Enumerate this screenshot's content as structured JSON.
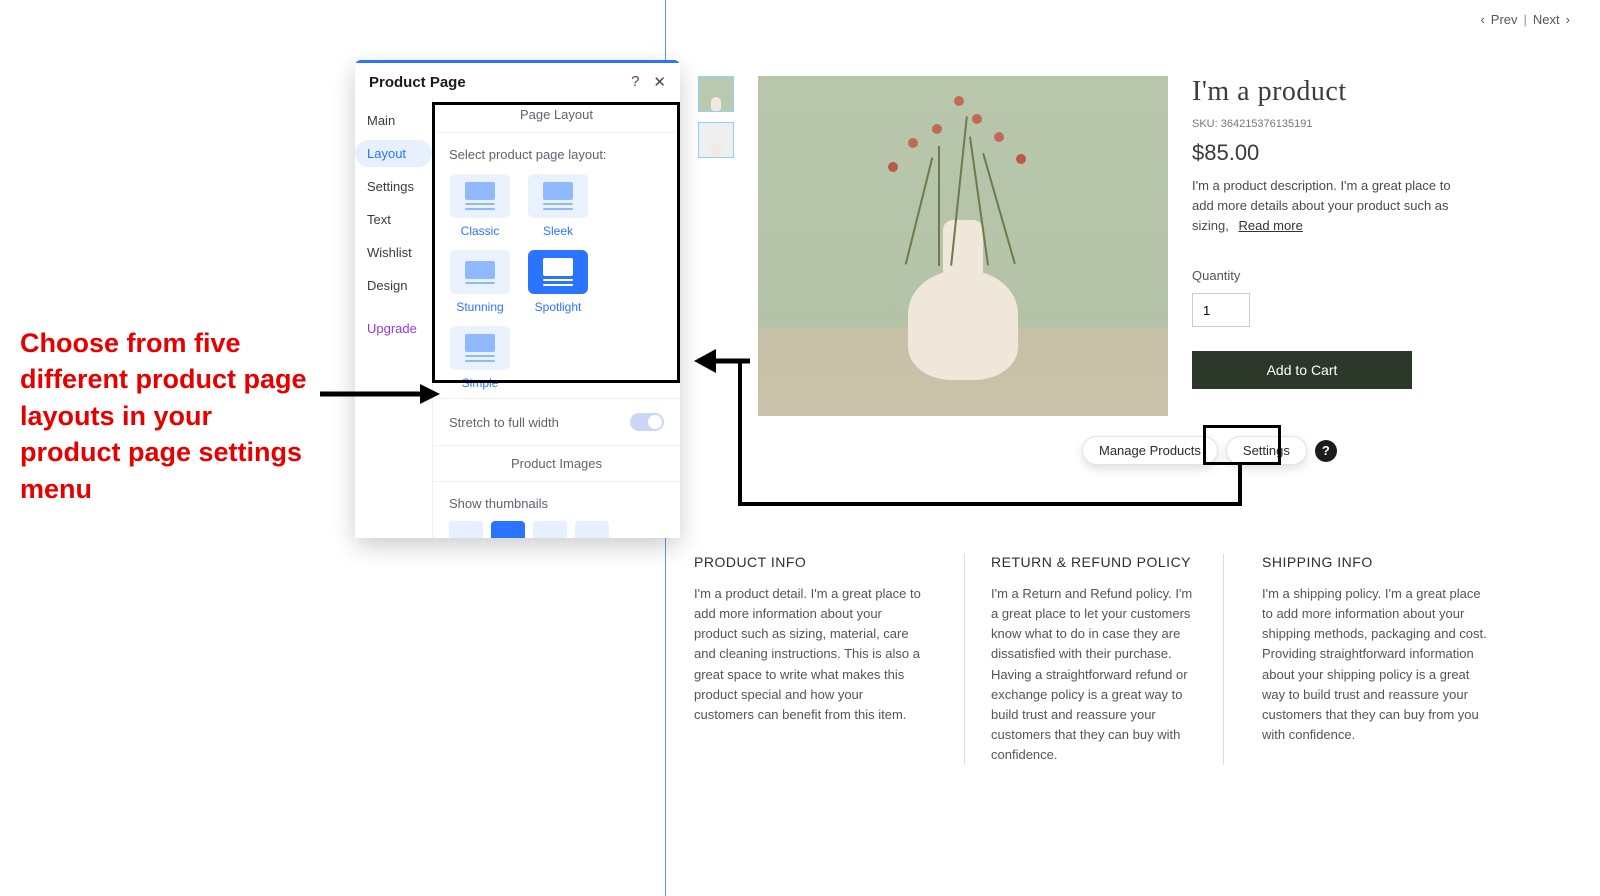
{
  "nav": {
    "prev": "Prev",
    "next": "Next"
  },
  "annotation": "Choose from five different product page layouts in your product page settings menu",
  "panel": {
    "title": "Product Page",
    "tabs": [
      "Main",
      "Layout",
      "Settings",
      "Text",
      "Wishlist",
      "Design"
    ],
    "upgrade": "Upgrade",
    "section_layout": "Page Layout",
    "select_label": "Select product page layout:",
    "layouts": [
      "Classic",
      "Sleek",
      "Stunning",
      "Spotlight",
      "Simple"
    ],
    "stretch_label": "Stretch to full width",
    "section_images": "Product Images",
    "show_thumbs": "Show thumbnails"
  },
  "chips": {
    "manage": "Manage Products",
    "settings": "Settings"
  },
  "product": {
    "title": "I'm a product",
    "sku_label": "SKU: 364215376135191",
    "price": "$85.00",
    "desc": "I'm a product description. I'm a great place to add more details about your product such as sizing,",
    "read_more": "Read more",
    "qty_label": "Quantity",
    "qty_value": "1",
    "add": "Add to Cart"
  },
  "info": {
    "col1_h": "PRODUCT INFO",
    "col1_p": "I'm a product detail. I'm a great place to add more information about your product such as sizing, material, care and cleaning instructions. This is also a great space to write what makes this product special and how your customers can benefit from this item.",
    "col2_h": "RETURN & REFUND POLICY",
    "col2_p": "I'm a Return and Refund policy. I'm a great place to let your customers know what to do in case they are dissatisfied with their purchase. Having a straightforward refund or exchange policy is a great way to build trust and reassure your customers that they can buy with confidence.",
    "col3_h": "SHIPPING INFO",
    "col3_p": "I'm a shipping policy. I'm a great place to add more information about your shipping methods, packaging and cost. Providing straightforward information about your shipping policy is a great way to build trust and reassure your customers that they can buy from you with confidence."
  }
}
